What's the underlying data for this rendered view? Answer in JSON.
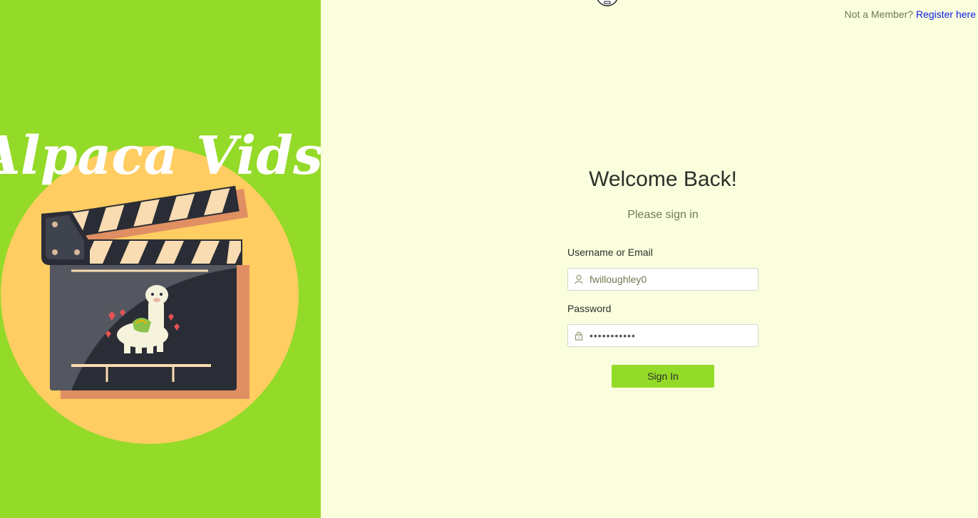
{
  "brand": {
    "logo_text": "Alpaca Vids",
    "colors": {
      "panel": "#94da28",
      "circle": "#ffcd61",
      "board": "#2a2d35",
      "accent": "#e08f62",
      "stripe": "#f9dcb2"
    }
  },
  "header": {
    "prompt": "Not a Member?",
    "register_link": "Register here"
  },
  "login": {
    "title": "Welcome Back!",
    "subtitle": "Please sign in",
    "username_label": "Username or Email",
    "username_value": "fwilloughley0",
    "password_label": "Password",
    "password_value": "•••••••••••",
    "submit_label": "Sign In"
  },
  "icons": {
    "username": "user-icon",
    "password": "lock-icon",
    "top": "circle-icon"
  }
}
